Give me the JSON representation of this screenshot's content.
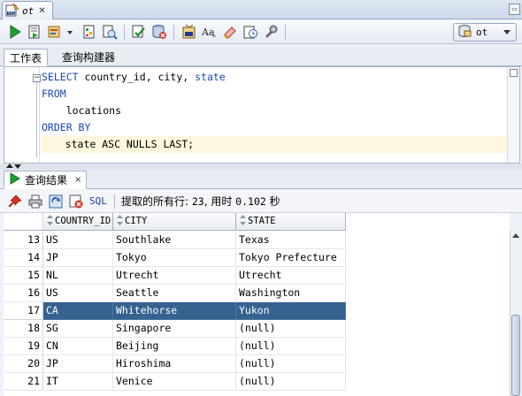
{
  "document_tab": {
    "label": "ot",
    "icon": "sql-worksheet-icon"
  },
  "toolbar": {
    "icons": [
      "run-statement-icon",
      "run-script-icon",
      "explain-plan-icon",
      "dropdown-arrow-icon",
      "autotrace-icon",
      "sql-tuning-icon",
      "commit-icon",
      "rollback-icon",
      "unshared-sql-icon",
      "to-upper-case-icon",
      "clear-icon",
      "sql-history-icon",
      "tools-icon"
    ],
    "connection": {
      "label": "ot",
      "icon": "database-connection-icon"
    }
  },
  "editor_tabs": [
    {
      "label": "工作表",
      "active": true
    },
    {
      "label": "查询构建器",
      "active": false
    }
  ],
  "editor": {
    "lines": [
      {
        "parts": [
          {
            "text": "SELECT",
            "kw": true
          },
          {
            "text": " country_id, city, ",
            "kw": false
          },
          {
            "text": "state",
            "kw": true
          }
        ]
      },
      {
        "parts": [
          {
            "text": "FROM",
            "kw": true
          }
        ]
      },
      {
        "parts": [
          {
            "text": "    locations",
            "kw": false
          }
        ]
      },
      {
        "parts": [
          {
            "text": "ORDER BY",
            "kw": true
          }
        ]
      },
      {
        "parts": [
          {
            "text": "    state ASC NULLS LAST;",
            "kw": false
          }
        ],
        "current": true
      }
    ]
  },
  "results_tab": {
    "label": "查询结果",
    "icon": "run-results-icon"
  },
  "results_toolbar": {
    "icons": [
      "pin-icon",
      "print-icon",
      "refresh-icon",
      "cancel-fetch-icon"
    ],
    "sql_label": "SQL",
    "status_prefix": "提取的所有行: ",
    "rows_fetched": "23",
    "status_middle": ", 用时 ",
    "elapsed": "0.102",
    "status_unit": " 秒"
  },
  "grid": {
    "columns": [
      "COUNTRY_ID",
      "CITY",
      "STATE"
    ],
    "rows": [
      {
        "n": "13",
        "country_id": "US",
        "city": "Southlake",
        "state": "Texas"
      },
      {
        "n": "14",
        "country_id": "JP",
        "city": "Tokyo",
        "state": "Tokyo Prefecture"
      },
      {
        "n": "15",
        "country_id": "NL",
        "city": "Utrecht",
        "state": "Utrecht"
      },
      {
        "n": "16",
        "country_id": "US",
        "city": "Seattle",
        "state": "Washington"
      },
      {
        "n": "17",
        "country_id": "CA",
        "city": "Whitehorse",
        "state": "Yukon",
        "selected": true
      },
      {
        "n": "18",
        "country_id": "SG",
        "city": "Singapore",
        "state": "(null)"
      },
      {
        "n": "19",
        "country_id": "CN",
        "city": "Beijing",
        "state": "(null)"
      },
      {
        "n": "20",
        "country_id": "JP",
        "city": "Hiroshima",
        "state": "(null)"
      },
      {
        "n": "21",
        "country_id": "IT",
        "city": "Venice",
        "state": "(null)"
      }
    ]
  },
  "colors": {
    "keyword": "#1c46b4",
    "selected_row": "#35628f",
    "current_line": "#fdf7dd"
  }
}
